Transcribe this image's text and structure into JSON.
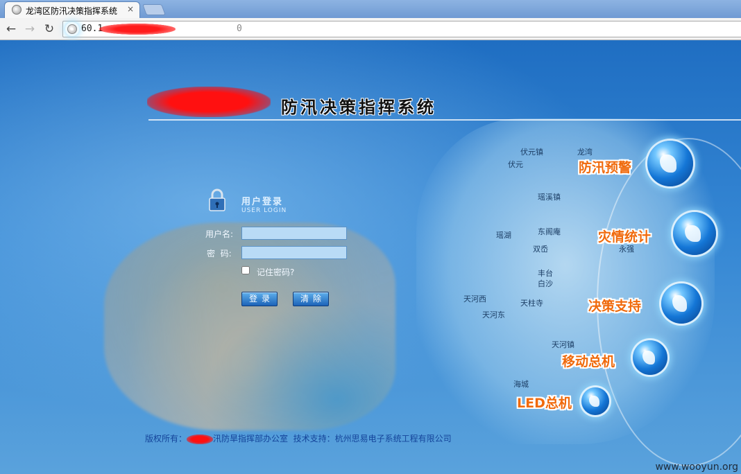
{
  "browser": {
    "tab_title": "龙湾区防汛决策指挥系统",
    "close_glyph": "×",
    "url_prefix": "60.1",
    "url_suffix": "0"
  },
  "header": {
    "system_title": "防汛决策指挥系统"
  },
  "login": {
    "title": "用户登录",
    "subtitle": "USER LOGIN",
    "username_label": "用户名:",
    "password_label": "密  码:",
    "remember_label": "记住密码?",
    "login_button": "登录",
    "clear_button": "清除"
  },
  "menu": [
    {
      "label": "防汛预警"
    },
    {
      "label": "灾情统计"
    },
    {
      "label": "决策支持"
    },
    {
      "label": "移动总机"
    },
    {
      "label": "LED总机"
    }
  ],
  "map_places": [
    "伏元镇",
    "龙湾",
    "伏元",
    "瑶溪镇",
    "瑶湖",
    "东阁庵",
    "双岙",
    "永强",
    "丰台",
    "白沙",
    "天河西",
    "天柱寺",
    "天河东",
    "天河镇",
    "海城"
  ],
  "footer": {
    "copyright_prefix": "版权所有：",
    "copyright_owner_suffix": "汛防旱指挥部办公室",
    "tech_support": "技术支持：杭州思易电子系统工程有限公司"
  },
  "watermark": "www.wooyun.org",
  "colors": {
    "menu_text": "#f06a0c",
    "background": "#2b78c8"
  }
}
